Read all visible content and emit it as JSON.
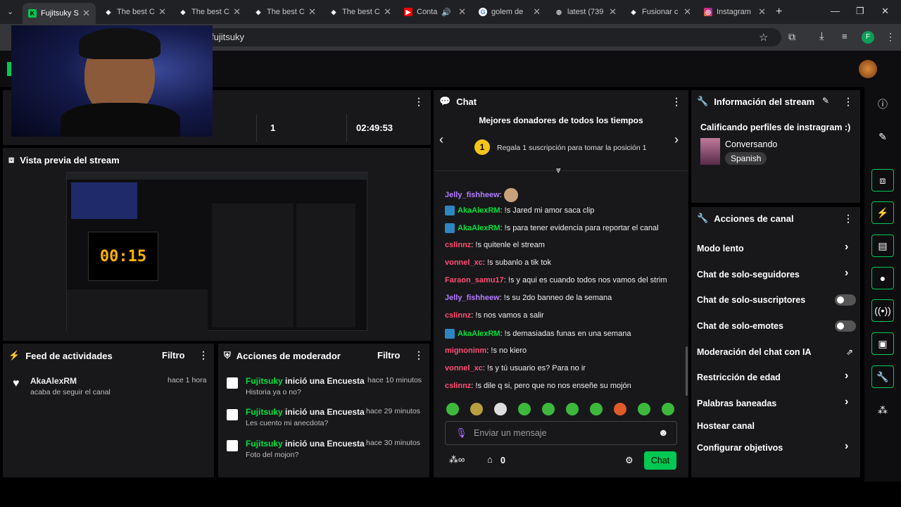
{
  "browser": {
    "tabs": [
      {
        "label": "Fujitsuky S",
        "icon": "twitch-icon",
        "active": true
      },
      {
        "label": "The best C",
        "icon": "chatgpt-icon"
      },
      {
        "label": "The best C",
        "icon": "chatgpt-icon"
      },
      {
        "label": "The best C",
        "icon": "chatgpt-icon"
      },
      {
        "label": "The best C",
        "icon": "chatgpt-icon"
      },
      {
        "label": "Conta",
        "icon": "youtube-icon"
      },
      {
        "label": "golem de",
        "icon": "google-icon"
      },
      {
        "label": "latest (739",
        "icon": "globe-icon"
      },
      {
        "label": "Fusionar c",
        "icon": "openai-icon"
      },
      {
        "label": "Instagram",
        "icon": "instagram-icon"
      }
    ],
    "url": "fujitsuky",
    "profile_initial": "F"
  },
  "stats": {
    "followers": "1",
    "time": "02:49:53"
  },
  "preview": {
    "title": "Vista previa del stream",
    "timer": "00:15"
  },
  "activity": {
    "title": "Feed de actividades",
    "filter": "Filtro",
    "items": [
      {
        "user": "AkaAlexRM",
        "desc": "acaba de seguir el canal",
        "time": "hace 1 hora"
      }
    ]
  },
  "mod": {
    "title": "Acciones de moderador",
    "filter": "Filtro",
    "items": [
      {
        "user": "Fujitsuky",
        "action": "inició una Encuesta",
        "time": "hace 10 minutos",
        "detail": "Historia ya o no?"
      },
      {
        "user": "Fujitsuky",
        "action": "inició una Encuesta",
        "time": "hace 29 minutos",
        "detail": "Les cuento mi anecdota?"
      },
      {
        "user": "Fujitsuky",
        "action": "inició una Encuesta",
        "time": "hace 30 minutos",
        "detail": "Foto del mojon?"
      }
    ]
  },
  "chat": {
    "title": "Chat",
    "donors_title": "Mejores donadores de todos los tiempos",
    "donors_rank": "1",
    "donors_text": "Regala 1 suscripción para tomar la posición 1",
    "messages": [
      {
        "user": "Jelly_fishheew",
        "color": "#b57bff",
        "text": ""
      },
      {
        "user": "AkaAlexRM",
        "color": "#00e040",
        "text": "!s Jared mi amor saca clip",
        "badge": true
      },
      {
        "user": "AkaAlexRM",
        "color": "#00e040",
        "text": "!s para tener evidencia para reportar el canal",
        "badge": true
      },
      {
        "user": "cslinnz",
        "color": "#ff4f73",
        "text": "!s quitenle el stream"
      },
      {
        "user": "vonnel_xc",
        "color": "#ff4f73",
        "text": "!s subanlo a tik tok"
      },
      {
        "user": "Faraon_samu17",
        "color": "#ff4f73",
        "text": "!s y aqui es cuando todos nos vamos del strim"
      },
      {
        "user": "Jelly_fishheew",
        "color": "#b57bff",
        "text": "!s su 2do banneo de la semana"
      },
      {
        "user": "cslinnz",
        "color": "#ff4f73",
        "text": "!s nos vamos a salir"
      },
      {
        "user": "AkaAlexRM",
        "color": "#00e040",
        "text": "!s demasiadas funas en una semana",
        "badge": true
      },
      {
        "user": "mignoninm",
        "color": "#ff4f73",
        "text": "!s no kiero"
      },
      {
        "user": "vonnel_xc",
        "color": "#ff4f73",
        "text": "!s y tú usuario es? Para no ir"
      },
      {
        "user": "cslinnz",
        "color": "#ff4f73",
        "text": "!s dile q si, pero que no nos enseñe su mojón"
      }
    ],
    "input_placeholder": "Enviar un mensaje",
    "points": "0",
    "send_label": "Chat"
  },
  "info": {
    "title": "Información del stream",
    "stream_title": "Calificando perfiles de instragram :)",
    "category": "Conversando",
    "language": "Spanish"
  },
  "actions": {
    "title": "Acciones de canal",
    "items": [
      {
        "label": "Modo lento",
        "control": "chevron"
      },
      {
        "label": "Chat de solo-seguidores",
        "control": "chevron"
      },
      {
        "label": "Chat de solo-suscriptores",
        "control": "toggle"
      },
      {
        "label": "Chat de solo-emotes",
        "control": "toggle"
      },
      {
        "label": "Moderación del chat con IA",
        "control": "external"
      },
      {
        "label": "Restricción de edad",
        "control": "chevron"
      },
      {
        "label": "Palabras baneadas",
        "control": "chevron"
      },
      {
        "label": "Hostear canal",
        "control": "none"
      },
      {
        "label": "Configurar objetivos",
        "control": "chevron"
      }
    ]
  },
  "colors": {
    "accent": "#00c853",
    "bg": "#0e0e10",
    "panel": "#18181b"
  }
}
